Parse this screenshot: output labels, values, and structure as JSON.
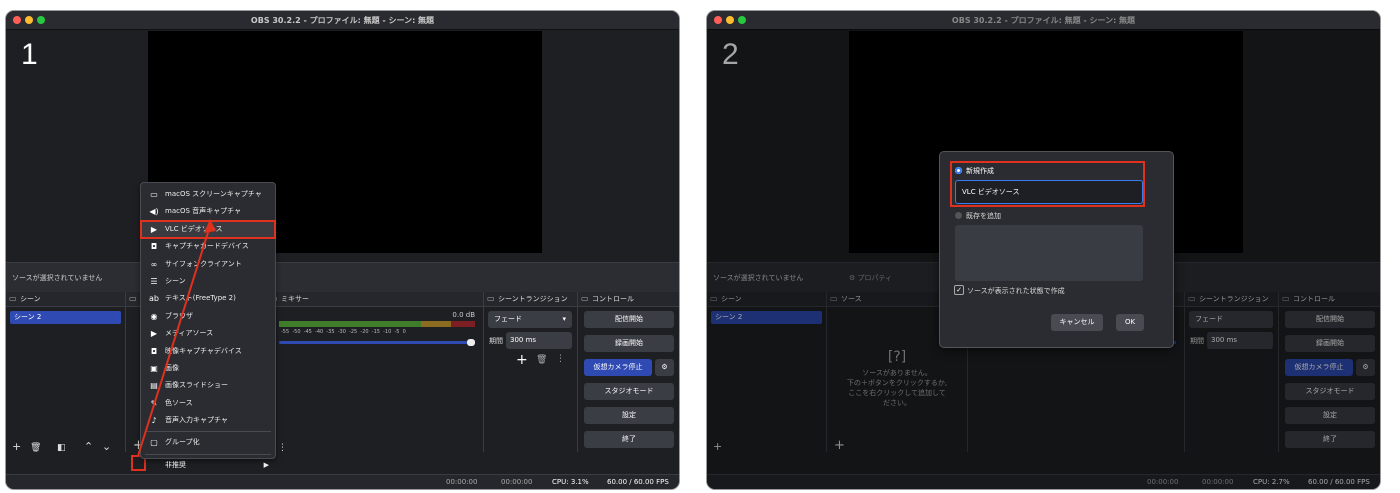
{
  "window_title": "OBS 30.2.2 - プロファイル: 無題 - シーン: 無題",
  "step1": "1",
  "step2": "2",
  "no_source_selected": "ソースが選択されていません",
  "properties_label": "プロパティ",
  "panels": {
    "scenes": "シーン",
    "sources": "ソース",
    "mixer": "ミキサー",
    "transitions": "シーントランジション",
    "controls": "コントロール"
  },
  "scene_item": "シーン 2",
  "mixer_db": "0.0 dB",
  "mixer_ticks": "-55  -50  -45  -40  -35  -30  -25  -20  -15  -10  -5  0",
  "transition": {
    "type": "フェード",
    "duration_label": "期間",
    "duration": "300 ms"
  },
  "controls": {
    "start_stream": "配信開始",
    "start_record": "録画開始",
    "virtual_cam": "仮想カメラ停止",
    "studio_mode": "スタジオモード",
    "settings": "設定",
    "exit": "終了"
  },
  "empty_sources": [
    "ソースがありません。",
    "下の＋ボタンをクリックするか,",
    "ここを右クリックして追加して",
    "ださい。"
  ],
  "status": {
    "time1": "00:00:00",
    "time2": "00:00:00",
    "cpu1": "CPU: 3.1%",
    "cpu2": "CPU: 2.7%",
    "fps": "60.00 / 60.00 FPS"
  },
  "menu_items": [
    {
      "icon": "monitor-icon",
      "glyph": "▭",
      "label": "macOS スクリーンキャプチャ"
    },
    {
      "icon": "speaker-icon",
      "glyph": "◀)",
      "label": "macOS 音声キャプチャ"
    },
    {
      "icon": "play-icon",
      "glyph": "▶",
      "label": "VLC ビデオソース"
    },
    {
      "icon": "camera-icon",
      "glyph": "◘",
      "label": "キャプチャカードデバイス"
    },
    {
      "icon": "link-icon",
      "glyph": "∞",
      "label": "サイフォンクライアント"
    },
    {
      "icon": "list-icon",
      "glyph": "☰",
      "label": "シーン"
    },
    {
      "icon": "text-icon",
      "glyph": "ab",
      "label": "テキスト(FreeType 2)"
    },
    {
      "icon": "globe-icon",
      "glyph": "◉",
      "label": "ブラウザ"
    },
    {
      "icon": "media-icon",
      "glyph": "▶",
      "label": "メディアソース"
    },
    {
      "icon": "camera-icon",
      "glyph": "◘",
      "label": "映像キャプチャデバイス"
    },
    {
      "icon": "image-icon",
      "glyph": "▣",
      "label": "画像"
    },
    {
      "icon": "slideshow-icon",
      "glyph": "▤",
      "label": "画像スライドショー"
    },
    {
      "icon": "brush-icon",
      "glyph": "✎",
      "label": "色ソース"
    },
    {
      "icon": "mic-icon",
      "glyph": "♪",
      "label": "音声入力キャプチャ"
    },
    {
      "icon": "group-icon",
      "glyph": "▢",
      "label": "グループ化"
    },
    {
      "icon": "submenu-icon",
      "glyph": "",
      "label": "非推奨"
    }
  ],
  "dialog": {
    "create_new": "新規作成",
    "name_value": "VLC ビデオソース",
    "add_existing": "既存を追加",
    "make_visible": "ソースが表示された状態で作成",
    "cancel": "キャンセル",
    "ok": "OK"
  }
}
